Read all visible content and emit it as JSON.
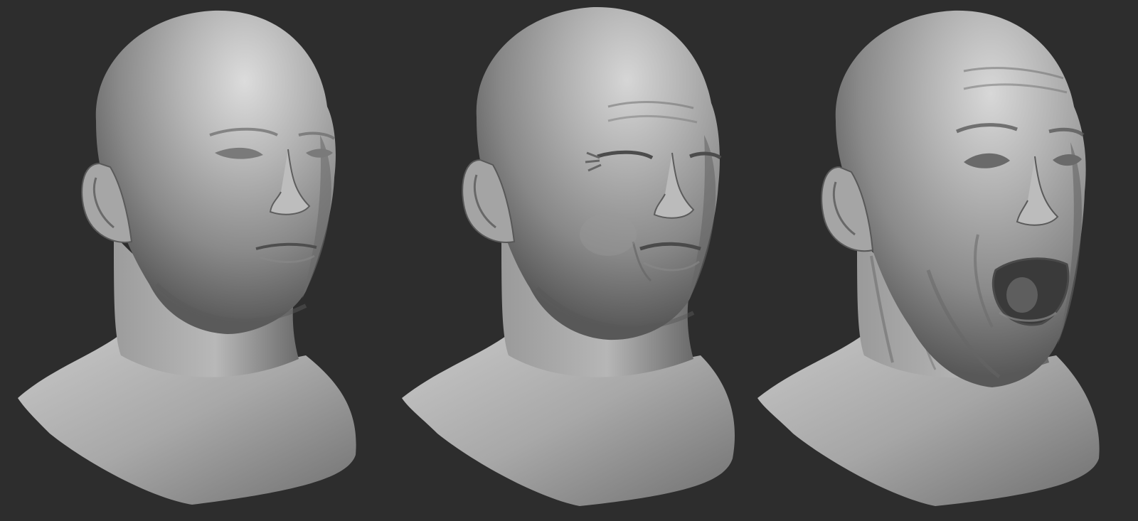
{
  "scene": {
    "background_color": "#2d2d2d",
    "sculpt_base_color": "#9a9a9a",
    "sculpt_highlight_color": "#d6d6d6",
    "sculpt_shadow_color": "#4a4a4a"
  },
  "busts": [
    {
      "id": "neutral",
      "expression": "neutral"
    },
    {
      "id": "squint",
      "expression": "squint-grimace"
    },
    {
      "id": "yell",
      "expression": "open-mouth-yell"
    }
  ]
}
